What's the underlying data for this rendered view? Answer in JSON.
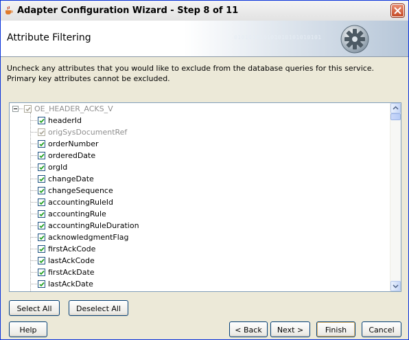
{
  "window": {
    "title": "Adapter Configuration Wizard - Step 8 of 11"
  },
  "banner": {
    "title": "Attribute Filtering",
    "binary": "010101010101010101010101"
  },
  "instructions": "Uncheck any attributes that you would like to exclude from the database queries for this service.  Primary key attributes cannot be excluded.",
  "tree": {
    "root": {
      "label": "OE_HEADER_ACKS_V",
      "checked": true,
      "disabled": true
    },
    "items": [
      {
        "label": "headerId",
        "checked": true,
        "disabled": false
      },
      {
        "label": "origSysDocumentRef",
        "checked": true,
        "disabled": true
      },
      {
        "label": "orderNumber",
        "checked": true,
        "disabled": false
      },
      {
        "label": "orderedDate",
        "checked": true,
        "disabled": false
      },
      {
        "label": "orgId",
        "checked": true,
        "disabled": false
      },
      {
        "label": "changeDate",
        "checked": true,
        "disabled": false
      },
      {
        "label": "changeSequence",
        "checked": true,
        "disabled": false
      },
      {
        "label": "accountingRuleId",
        "checked": true,
        "disabled": false
      },
      {
        "label": "accountingRule",
        "checked": true,
        "disabled": false
      },
      {
        "label": "accountingRuleDuration",
        "checked": true,
        "disabled": false
      },
      {
        "label": "acknowledgmentFlag",
        "checked": true,
        "disabled": false
      },
      {
        "label": "firstAckCode",
        "checked": true,
        "disabled": false
      },
      {
        "label": "lastAckCode",
        "checked": true,
        "disabled": false
      },
      {
        "label": "firstAckDate",
        "checked": true,
        "disabled": false
      },
      {
        "label": "lastAckDate",
        "checked": true,
        "disabled": false
      }
    ]
  },
  "buttons": {
    "select_all": "Select All",
    "deselect_all": "Deselect All",
    "help": "Help",
    "back": "< Back",
    "next": "Next >",
    "finish": "Finish",
    "cancel": "Cancel"
  },
  "colors": {
    "accent": "#0831d9",
    "checkmark": "#21a121",
    "banner_gradient_end": "#b6c6d8"
  }
}
